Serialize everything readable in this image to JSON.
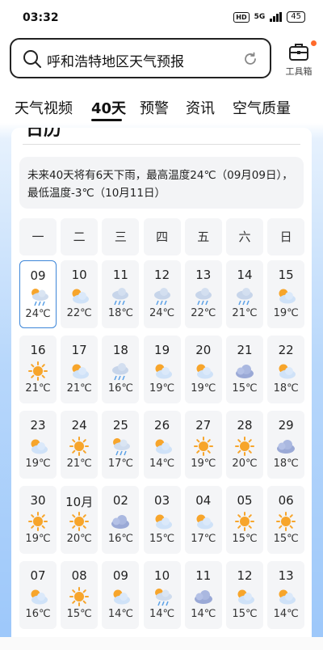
{
  "status": {
    "time": "03:32",
    "hd": "HD",
    "network": "5G",
    "battery": "45"
  },
  "search": {
    "query": "呼和浩特地区天气预报"
  },
  "toolbox": {
    "label": "工具箱"
  },
  "tabs": [
    "天气视频",
    "40天",
    "预警",
    "资讯",
    "空气质量"
  ],
  "card": {
    "heading": "日历",
    "summary": "未来40天将有6天下雨，最高温度24℃（09月09日），最低温度-3℃（10月11日）"
  },
  "weekdays": [
    "一",
    "二",
    "三",
    "四",
    "五",
    "六",
    "日"
  ],
  "days": [
    {
      "d": "09",
      "t": "24℃",
      "i": "rain-sun-icon",
      "sel": true
    },
    {
      "d": "10",
      "t": "22℃",
      "i": "partly-cloudy-icon"
    },
    {
      "d": "11",
      "t": "18℃",
      "i": "rain-icon"
    },
    {
      "d": "12",
      "t": "24℃",
      "i": "rain-icon"
    },
    {
      "d": "13",
      "t": "22℃",
      "i": "rain-icon"
    },
    {
      "d": "14",
      "t": "21℃",
      "i": "rain-icon"
    },
    {
      "d": "15",
      "t": "19℃",
      "i": "partly-cloudy-icon"
    },
    {
      "d": "16",
      "t": "21℃",
      "i": "sun-icon"
    },
    {
      "d": "17",
      "t": "21℃",
      "i": "partly-cloudy-icon"
    },
    {
      "d": "18",
      "t": "16℃",
      "i": "rain-icon"
    },
    {
      "d": "19",
      "t": "19℃",
      "i": "partly-cloudy-icon"
    },
    {
      "d": "20",
      "t": "19℃",
      "i": "partly-cloudy-icon"
    },
    {
      "d": "21",
      "t": "15℃",
      "i": "cloudy-icon"
    },
    {
      "d": "22",
      "t": "18℃",
      "i": "partly-cloudy-icon"
    },
    {
      "d": "23",
      "t": "19℃",
      "i": "partly-cloudy-icon"
    },
    {
      "d": "24",
      "t": "21℃",
      "i": "sun-icon"
    },
    {
      "d": "25",
      "t": "17℃",
      "i": "rain-sun-icon"
    },
    {
      "d": "26",
      "t": "14℃",
      "i": "partly-cloudy-icon"
    },
    {
      "d": "27",
      "t": "19℃",
      "i": "sun-icon"
    },
    {
      "d": "28",
      "t": "20℃",
      "i": "sun-icon"
    },
    {
      "d": "29",
      "t": "18℃",
      "i": "cloudy-icon"
    },
    {
      "d": "30",
      "t": "19℃",
      "i": "sun-icon"
    },
    {
      "d": "10月",
      "t": "20℃",
      "i": "sun-icon"
    },
    {
      "d": "02",
      "t": "16℃",
      "i": "cloudy-icon"
    },
    {
      "d": "03",
      "t": "15℃",
      "i": "partly-cloudy-icon"
    },
    {
      "d": "04",
      "t": "17℃",
      "i": "partly-cloudy-icon"
    },
    {
      "d": "05",
      "t": "15℃",
      "i": "sun-icon"
    },
    {
      "d": "06",
      "t": "15℃",
      "i": "sun-icon"
    },
    {
      "d": "07",
      "t": "16℃",
      "i": "partly-cloudy-icon"
    },
    {
      "d": "08",
      "t": "15℃",
      "i": "sun-icon"
    },
    {
      "d": "09",
      "t": "14℃",
      "i": "partly-cloudy-icon"
    },
    {
      "d": "10",
      "t": "14℃",
      "i": "rain-sun-icon"
    },
    {
      "d": "11",
      "t": "14℃",
      "i": "cloudy-icon"
    },
    {
      "d": "12",
      "t": "15℃",
      "i": "partly-cloudy-icon"
    },
    {
      "d": "13",
      "t": "14℃",
      "i": "partly-cloudy-icon"
    }
  ]
}
